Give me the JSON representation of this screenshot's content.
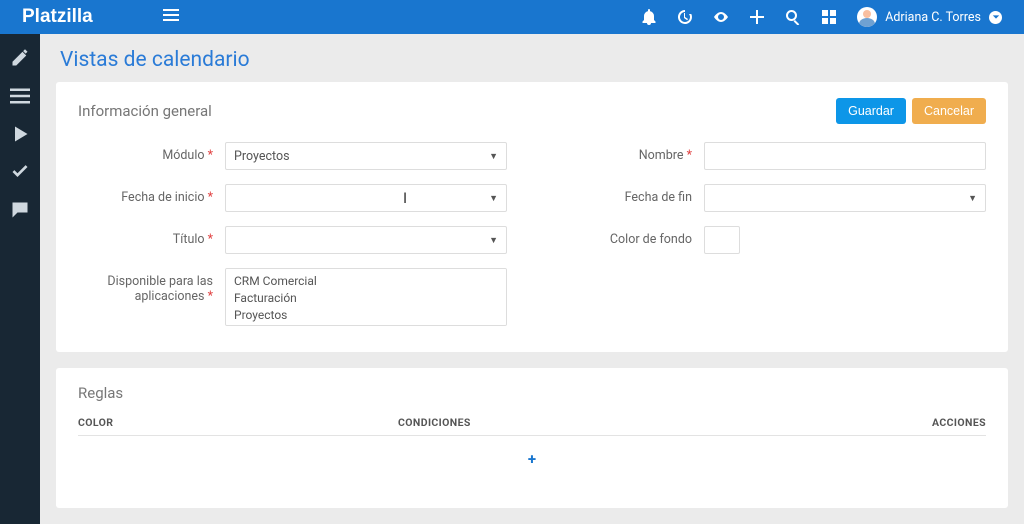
{
  "brand": "Platzilla",
  "user": {
    "name": "Adriana C. Torres"
  },
  "page_title": "Vistas de calendario",
  "panel1": {
    "title": "Información general",
    "save": "Guardar",
    "cancel": "Cancelar"
  },
  "form": {
    "modulo": {
      "label": "Módulo",
      "value": "Proyectos"
    },
    "nombre": {
      "label": "Nombre",
      "value": ""
    },
    "fecha_inicio": {
      "label": "Fecha de inicio",
      "value": ""
    },
    "fecha_fin": {
      "label": "Fecha de fin",
      "value": ""
    },
    "titulo": {
      "label": "Título",
      "value": ""
    },
    "color_fondo": {
      "label": "Color de fondo"
    },
    "disponible_label1": "Disponible para las",
    "disponible_label2": "aplicaciones",
    "apps": {
      "opt1": "CRM Comercial",
      "opt2": "Facturación",
      "opt3": "Proyectos"
    }
  },
  "rules": {
    "title": "Reglas",
    "col_color": "COLOR",
    "col_cond": "CONDICIONES",
    "col_act": "ACCIONES",
    "add": "+"
  }
}
